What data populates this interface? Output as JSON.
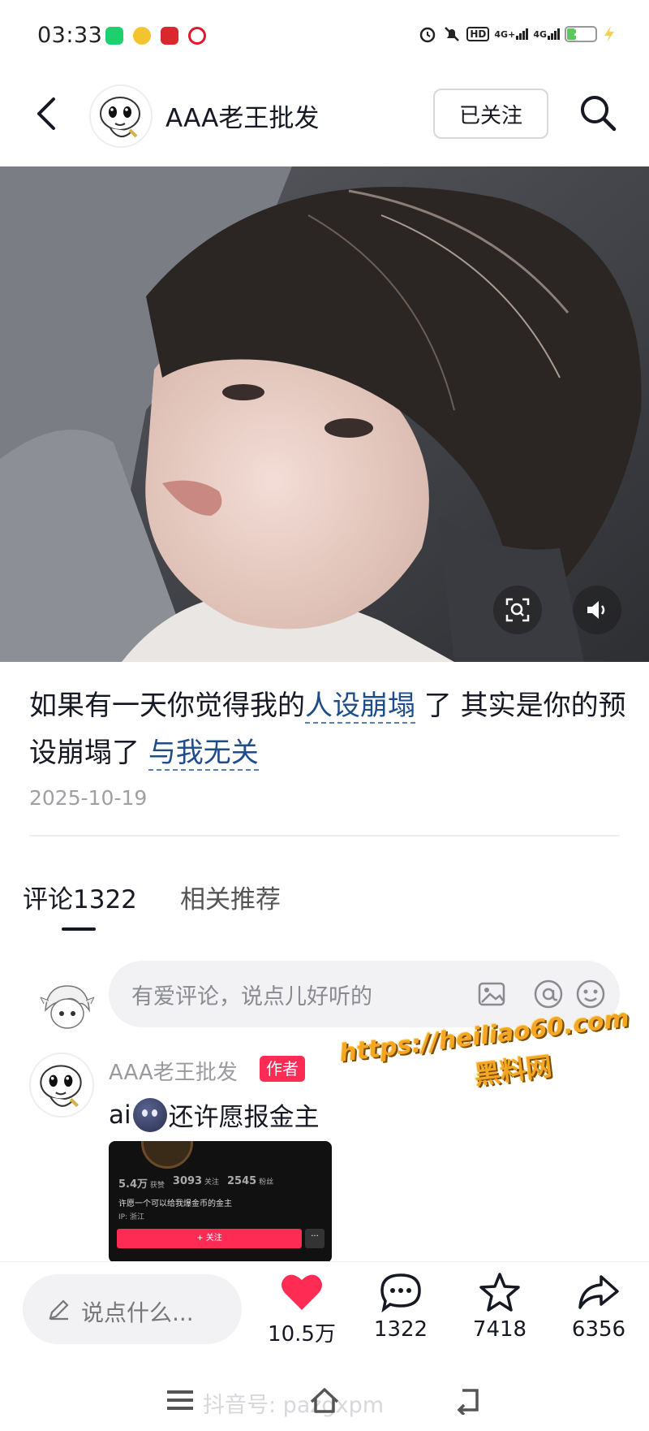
{
  "status_bar": {
    "time": "03:33",
    "notification_icons": [
      "app-green-icon",
      "app-yellow-icon",
      "app-red-icon",
      "weibo-icon"
    ],
    "system_icons": [
      "alarm-icon",
      "mute-icon",
      "hd-icon",
      "signal-4g-plus-icon",
      "signal-4g-icon",
      "battery-icon",
      "charging-icon"
    ],
    "hd_label": "HD",
    "net1_label": "4G+",
    "net2_label": "4G",
    "battery_level": "24"
  },
  "header": {
    "username": "AAA老王批发",
    "follow_label": "已关注"
  },
  "post": {
    "caption_parts": {
      "p1": "如果有一天你觉得我的",
      "tag1": "人设崩塌",
      "p2": " 了 其实是你的预设崩塌了 ",
      "tag2": "与我无关"
    },
    "date": "2025-10-19"
  },
  "tabs": [
    {
      "label": "评论1322",
      "active": true
    },
    {
      "label": "相关推荐",
      "active": false
    }
  ],
  "comment_input": {
    "placeholder": "有爱评论，说点儿好听的"
  },
  "comment": {
    "username": "AAA老王批发",
    "badge": "作者",
    "text_prefix": "ai",
    "text_suffix": "还许愿报金主",
    "screenshot": {
      "likes": "5.4万",
      "likes_label": "获赞",
      "following": "3093",
      "following_label": "关注",
      "fans": "2545",
      "fans_label": "粉丝",
      "desc": "许愿一个可以给我爆金币的金主",
      "ip": "IP: 浙江",
      "follow_btn": "+ 关注",
      "more": "···"
    }
  },
  "watermark": {
    "url": "https://heiliao60.com",
    "name": "黑料网"
  },
  "bottom_bar": {
    "input_placeholder": "说点什么...",
    "likes": "10.5万",
    "comments": "1322",
    "favorites": "7418",
    "shares": "6356"
  },
  "nav_bar": {
    "ghost_text": "抖音号: pazgxpm"
  },
  "colors": {
    "accent_red": "#fe2c55",
    "tag_blue": "#1f4d8c",
    "watermark_orange": "#f5a623"
  }
}
